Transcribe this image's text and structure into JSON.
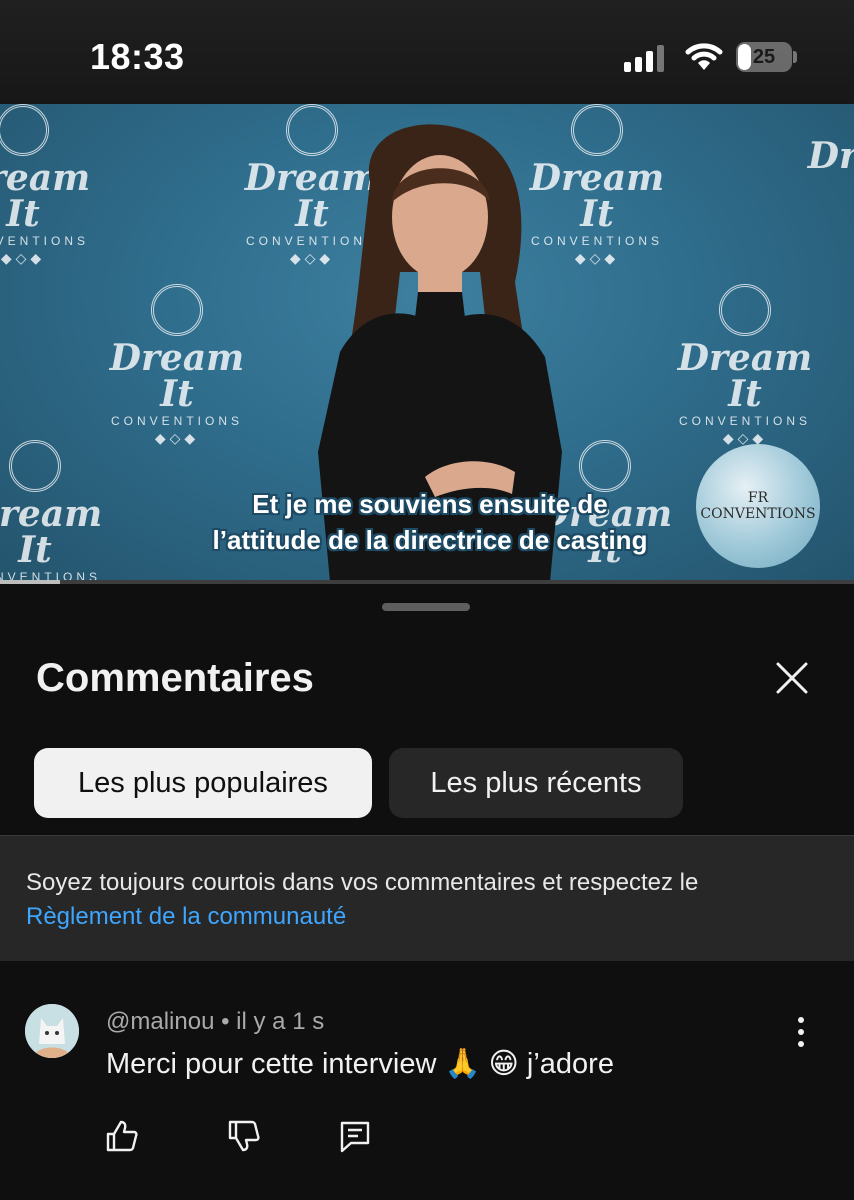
{
  "status_bar": {
    "time": "18:33",
    "battery_level": "25",
    "battery_fraction": 0.25,
    "signal_bars": 4,
    "icons": [
      "cellular-signal-icon",
      "wifi-icon",
      "battery-icon"
    ]
  },
  "video": {
    "caption_line1": "Et je me souviens ensuite de",
    "caption_line2": "l’attitude de la directrice de casting",
    "backdrop_brand_name": "Dream It",
    "backdrop_brand_sub": "CONVENTIONS",
    "watermark_text": "FR CONVENTIONS",
    "progress_fraction": 0.07,
    "colors": {
      "backdrop": "#2f6d8c",
      "caption_outline": "#1d4a64"
    }
  },
  "comments_sheet": {
    "title": "Commentaires",
    "close_icon": "close-icon",
    "filters": [
      {
        "label": "Les plus populaires",
        "selected": true
      },
      {
        "label": "Les plus récents",
        "selected": false
      }
    ],
    "notice_text": "Soyez toujours courtois dans vos commentaires et respectez le",
    "notice_link": "Règlement de la communauté",
    "comments": [
      {
        "author": "@malinou",
        "separator": "•",
        "time": "il y a 1 s",
        "text": "Merci pour cette interview 🙏 😁 j’adore",
        "actions": [
          "like-icon",
          "dislike-icon",
          "reply-icon"
        ]
      }
    ]
  },
  "theme": {
    "background": "#0f0f0f",
    "link": "#3ea6ff",
    "chip_active_bg": "#f1f1f1",
    "chip_inactive_bg": "#272727"
  }
}
